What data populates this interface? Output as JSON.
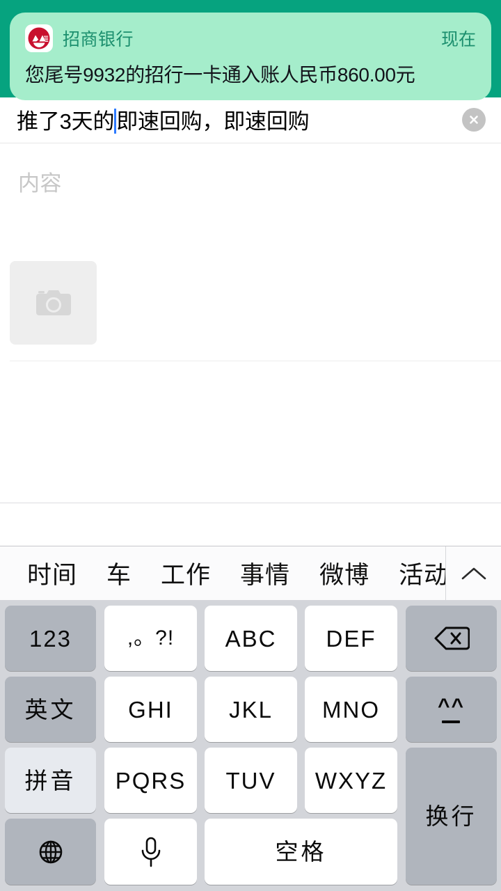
{
  "notification": {
    "app_name": "招商银行",
    "time": "现在",
    "message": "您尾号9932的招行一卡通入账人民币860.00元",
    "icon": "cmb-bank-logo-icon",
    "card_color": "#a5edcb",
    "backdrop_color": "#06a37f",
    "text_color": "#1c8f6e"
  },
  "editor": {
    "title_before_caret": "推了3天的",
    "title_after_caret": "即速回购，即速回购",
    "clear_icon": "close-circle-icon",
    "content_placeholder": "内容",
    "photo_icon": "camera-icon"
  },
  "candidates": {
    "items": [
      "时间",
      "车",
      "工作",
      "事情",
      "微博",
      "活动"
    ],
    "expand_icon": "chevron-up-icon"
  },
  "keyboard": {
    "keys": {
      "num": "123",
      "punct": ",。?!",
      "abc": "ABC",
      "def": "DEF",
      "backspace_icon": "backspace-icon",
      "english": "英文",
      "ghi": "GHI",
      "jkl": "JKL",
      "mno": "MNO",
      "emoji": "^^",
      "pinyin": "拼音",
      "pqrs": "PQRS",
      "tuv": "TUV",
      "wxyz": "WXYZ",
      "enter": "换行",
      "globe_icon": "globe-icon",
      "mic_icon": "microphone-icon",
      "space": "空格"
    }
  }
}
